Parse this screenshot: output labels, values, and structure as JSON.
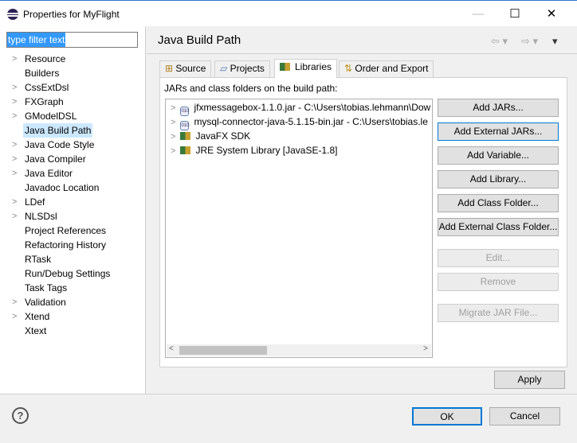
{
  "window": {
    "title": "Properties for MyFlight",
    "minimize": "—",
    "maximize": "☐",
    "close": "✕"
  },
  "filter": {
    "value": "type filter text"
  },
  "tree": [
    {
      "label": "Resource",
      "expandable": true
    },
    {
      "label": "Builders",
      "expandable": false
    },
    {
      "label": "CssExtDsl",
      "expandable": true
    },
    {
      "label": "FXGraph",
      "expandable": true
    },
    {
      "label": "GModelDSL",
      "expandable": true
    },
    {
      "label": "Java Build Path",
      "expandable": false,
      "selected": true
    },
    {
      "label": "Java Code Style",
      "expandable": true
    },
    {
      "label": "Java Compiler",
      "expandable": true
    },
    {
      "label": "Java Editor",
      "expandable": true
    },
    {
      "label": "Javadoc Location",
      "expandable": false
    },
    {
      "label": "LDef",
      "expandable": true
    },
    {
      "label": "NLSDsl",
      "expandable": true
    },
    {
      "label": "Project References",
      "expandable": false
    },
    {
      "label": "Refactoring History",
      "expandable": false
    },
    {
      "label": "RTask",
      "expandable": false
    },
    {
      "label": "Run/Debug Settings",
      "expandable": false
    },
    {
      "label": "Task Tags",
      "expandable": false
    },
    {
      "label": "Validation",
      "expandable": true
    },
    {
      "label": "Xtend",
      "expandable": true
    },
    {
      "label": "Xtext",
      "expandable": false
    }
  ],
  "page": {
    "title": "Java Build Path"
  },
  "tabs": [
    {
      "label": "Source",
      "icon": "⊞"
    },
    {
      "label": "Projects",
      "icon": "▱"
    },
    {
      "label": "Libraries",
      "icon": "▮"
    },
    {
      "label": "Order and Export",
      "icon": "⇅"
    }
  ],
  "libraries": {
    "caption": "JARs and class folders on the build path:",
    "items": [
      {
        "label": "jfxmessagebox-1.1.0.jar - C:\\Users\\tobias.lehmann\\Dow",
        "type": "jar"
      },
      {
        "label": "mysql-connector-java-5.1.15-bin.jar - C:\\Users\\tobias.le",
        "type": "jar"
      },
      {
        "label": "JavaFX SDK",
        "type": "library"
      },
      {
        "label": "JRE System Library [JavaSE-1.8]",
        "type": "library"
      }
    ]
  },
  "buttons": {
    "add_jars": "Add JARs...",
    "add_external_jars": "Add External JARs...",
    "add_variable": "Add Variable...",
    "add_library": "Add Library...",
    "add_class_folder": "Add Class Folder...",
    "add_external_class_folder": "Add External Class Folder...",
    "edit": "Edit...",
    "remove": "Remove",
    "migrate": "Migrate JAR File...",
    "apply": "Apply",
    "ok": "OK",
    "cancel": "Cancel",
    "help": "?"
  }
}
